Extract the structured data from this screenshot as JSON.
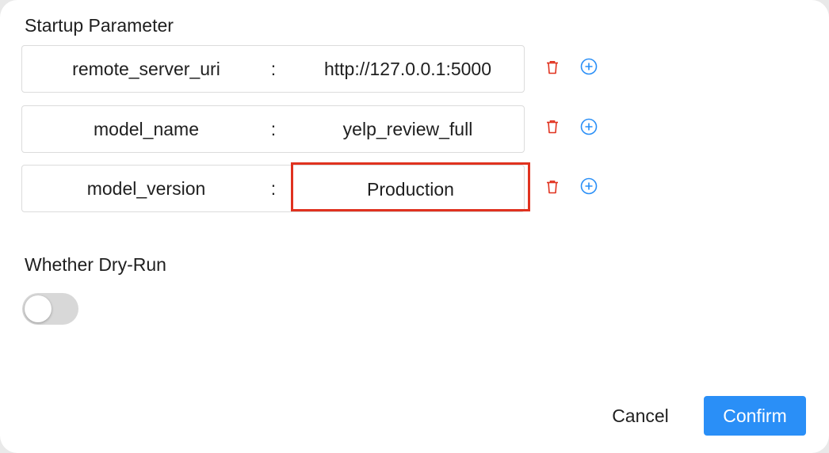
{
  "dialog": {
    "startup_label": "Startup Parameter",
    "params": [
      {
        "key": "remote_server_uri",
        "sep": ":",
        "value": "http://127.0.0.1:5000"
      },
      {
        "key": "model_name",
        "sep": ":",
        "value": "yelp_review_full"
      },
      {
        "key": "model_version",
        "sep": ":",
        "value": "Production"
      }
    ],
    "dry_run_label": "Whether Dry-Run",
    "dry_run_enabled": false,
    "cancel_label": "Cancel",
    "confirm_label": "Confirm"
  },
  "icons": {
    "delete": "trash-icon",
    "add": "plus-circle-icon"
  },
  "colors": {
    "accent": "#2a8ff7",
    "delete": "#e0321f",
    "highlight": "#e0321f"
  }
}
